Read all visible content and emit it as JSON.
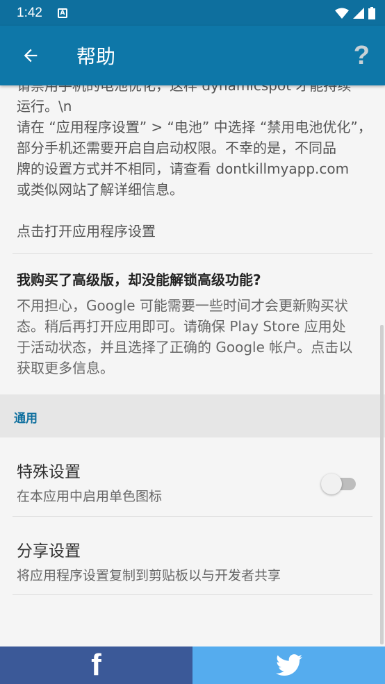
{
  "status_bar": {
    "time": "1:42",
    "notification_glyph": "A",
    "icons": [
      "wifi-icon",
      "signal-icon",
      "battery-icon"
    ]
  },
  "app_bar": {
    "title": "帮助",
    "back_icon": "arrow-back-icon",
    "help_icon": "?"
  },
  "battery_faq": {
    "partial_line": "请禁用手机的电池优化，这样 dynamicspot 才能持续",
    "text_lines": [
      "运行。\\n",
      "请在 “应用程序设置” > “电池” 中选择 “禁用电池优化”，",
      "部分手机还需要开启自启动权限。不幸的是，不同品",
      "牌的设置方式并不相同，请查看 dontkillmyapp.com",
      "或类似网站了解详细信息。"
    ],
    "link": "点击打开应用程序设置"
  },
  "premium_faq": {
    "question": "我购买了高级版，却没能解锁高级功能?",
    "answer_lines": [
      "不用担心，Google 可能需要一些时间才会更新购买状",
      "态。稍后再打开应用即可。请确保 Play Store 应用处",
      "于活动状态，并且选择了正确的 Google 帐户。点击以",
      "获取更多信息。"
    ]
  },
  "general": {
    "header": "通用",
    "special_settings": {
      "title": "特殊设置",
      "subtitle": "在本应用中启用单色图标",
      "toggle_on": false
    },
    "share_settings": {
      "title": "分享设置",
      "subtitle": "将应用程序设置复制到剪贴板以与开发者共享"
    }
  },
  "share_bar": {
    "facebook_glyph": "f",
    "facebook_color": "#3b5998",
    "twitter_color": "#55acee"
  },
  "colors": {
    "app_bar": "#0e77a8",
    "status_bar": "#0e6f9e",
    "accent": "#0e6f9e"
  }
}
